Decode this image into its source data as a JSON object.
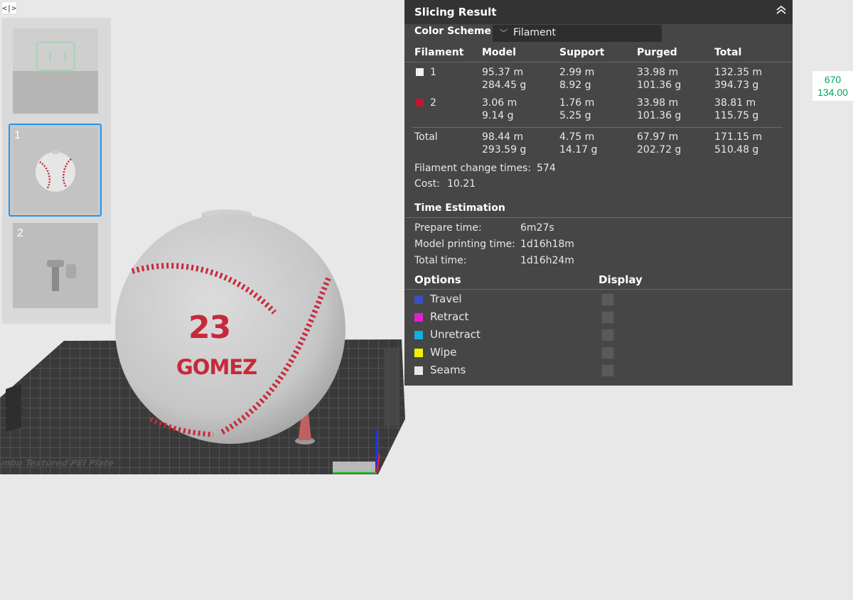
{
  "app": {
    "collapse_toggle_label": "<|>"
  },
  "plates": [
    {
      "number": ""
    },
    {
      "number": "1"
    },
    {
      "number": "2"
    }
  ],
  "model": {
    "jersey_number": "23",
    "player_name": "GOMEZ",
    "bed_label": "mbu Textured PEI Plate"
  },
  "scale_readout": {
    "top": "670",
    "bottom": "134.00"
  },
  "panel": {
    "title": "Slicing Result",
    "color_scheme_label": "Color Scheme",
    "color_scheme_value": "Filament",
    "columns": [
      "Filament",
      "Model",
      "Support",
      "Purged",
      "Total"
    ],
    "filaments": [
      {
        "id": "1",
        "color": "#f2f2f2",
        "model": [
          "95.37 m",
          "284.45 g"
        ],
        "support": [
          "2.99 m",
          "8.92 g"
        ],
        "purged": [
          "33.98 m",
          "101.36 g"
        ],
        "total": [
          "132.35 m",
          "394.73 g"
        ]
      },
      {
        "id": "2",
        "color": "#c0182f",
        "model": [
          "3.06 m",
          "9.14 g"
        ],
        "support": [
          "1.76 m",
          "5.25 g"
        ],
        "purged": [
          "33.98 m",
          "101.36 g"
        ],
        "total": [
          "38.81 m",
          "115.75 g"
        ]
      }
    ],
    "totals": {
      "label": "Total",
      "model": [
        "98.44 m",
        "293.59 g"
      ],
      "support": [
        "4.75 m",
        "14.17 g"
      ],
      "purged": [
        "67.97 m",
        "202.72 g"
      ],
      "total": [
        "171.15 m",
        "510.48 g"
      ]
    },
    "filament_change_label": "Filament change times:",
    "filament_change_value": "574",
    "cost_label": "Cost:",
    "cost_value": "10.21",
    "time_title": "Time Estimation",
    "times": [
      {
        "label": "Prepare time:",
        "value": "6m27s"
      },
      {
        "label": "Model printing time:",
        "value": "1d16h18m"
      },
      {
        "label": "Total time:",
        "value": "1d16h24m"
      }
    ],
    "options_title": "Options",
    "display_title": "Display",
    "options": [
      {
        "label": "Travel",
        "color": "#3a4fc0"
      },
      {
        "label": "Retract",
        "color": "#e020d0"
      },
      {
        "label": "Unretract",
        "color": "#10b0e0"
      },
      {
        "label": "Wipe",
        "color": "#f0f000"
      },
      {
        "label": "Seams",
        "color": "#e8e8e8"
      }
    ]
  }
}
